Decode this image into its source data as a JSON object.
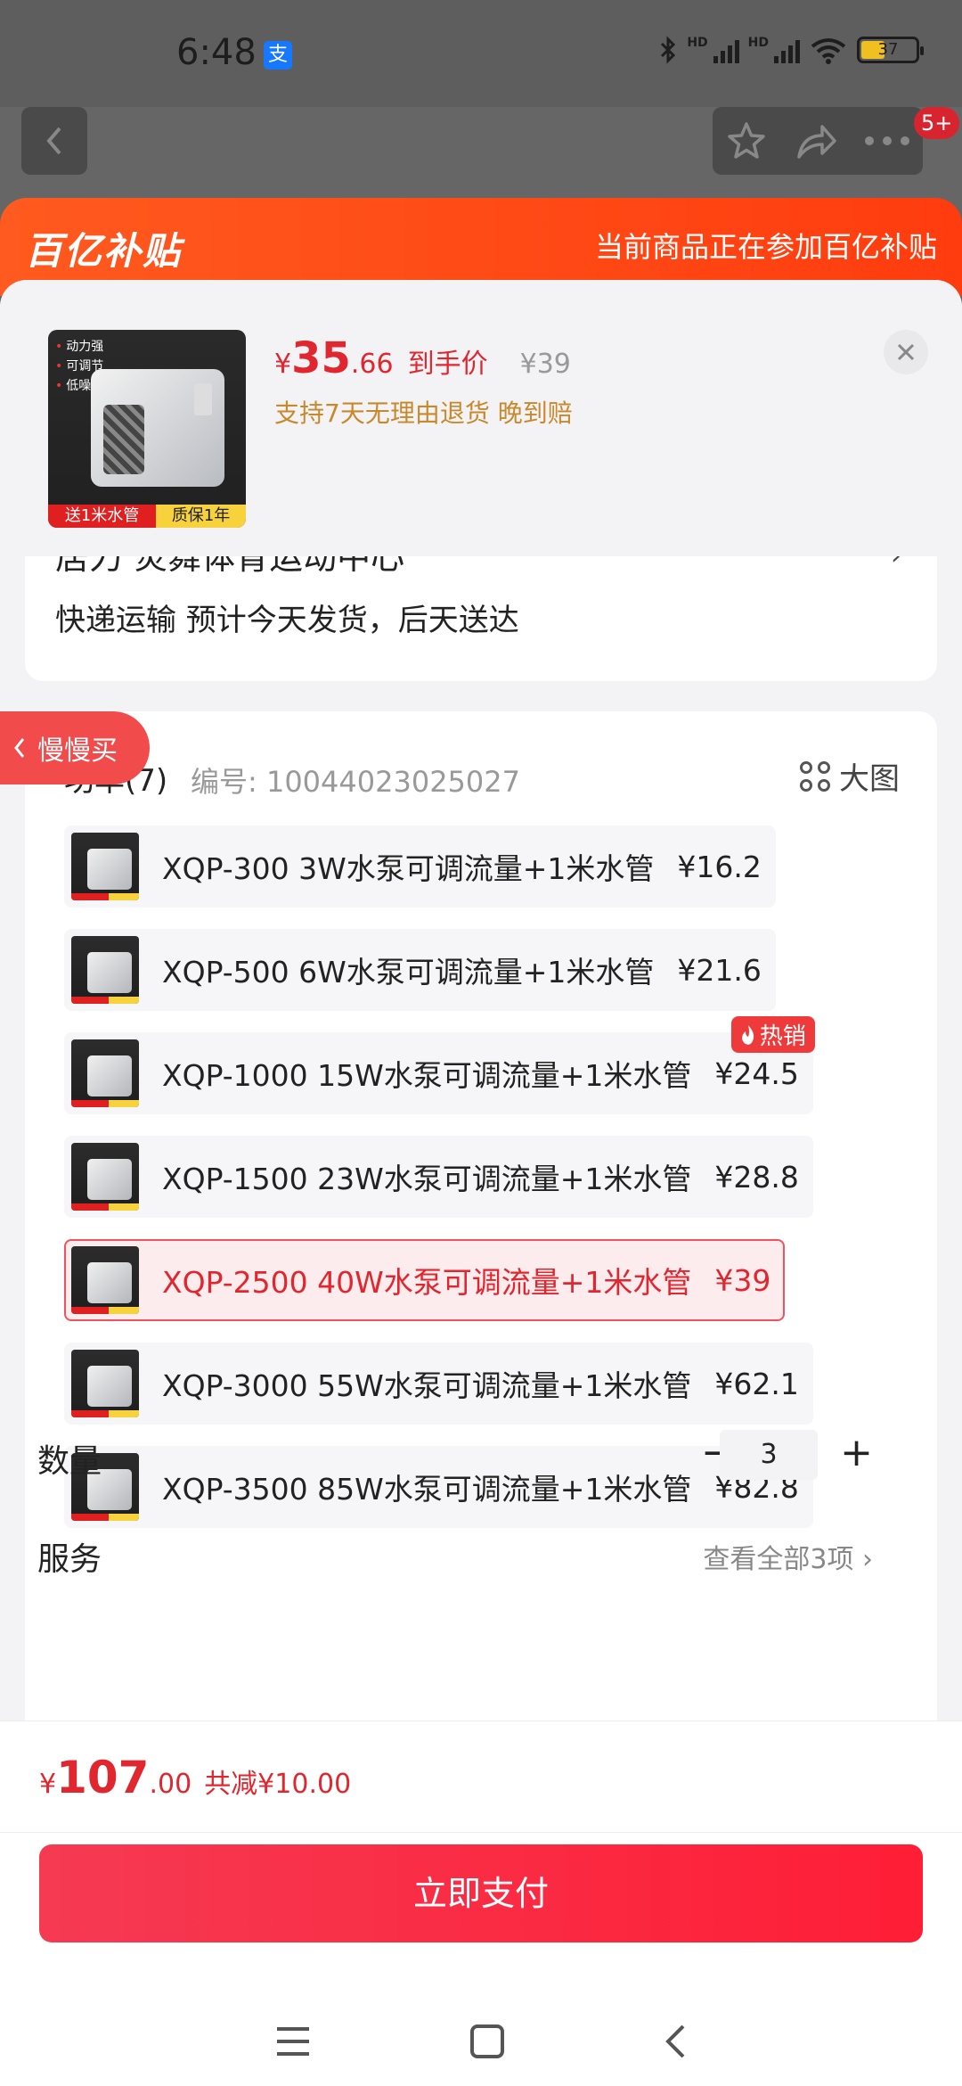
{
  "status": {
    "time": "6:48",
    "alipay": "支",
    "net1": "HD",
    "net2": "HD",
    "battery": "37"
  },
  "nav": {
    "badge": "5+"
  },
  "banner": {
    "logo": "百亿补贴",
    "text": "当前商品正在参加百亿补贴"
  },
  "product": {
    "thumb_tags": [
      "动力强",
      "可调节",
      "低噪音"
    ],
    "thumb_promo_left": "送1米水管",
    "thumb_promo_right": "质保1年",
    "price_symbol": "¥",
    "price_int": "35",
    "price_dec": ".66",
    "price_label": "到手价",
    "original_price": "¥39",
    "promise": "支持7天无理由退货  晚到赔"
  },
  "shipping": {
    "address_partial": "居力  炎舞体育运动中心",
    "arrow": "›",
    "text": "快递运输 预计今天发货，后天送达"
  },
  "side_tab": {
    "label": "慢慢买"
  },
  "options": {
    "title": "功率(7)",
    "code": "编号: 10044023025027",
    "view_label": "大图",
    "hot_label": "热销",
    "items": [
      {
        "name": "XQP-300 3W水泵可调流量+1米水管",
        "price": "¥16.2"
      },
      {
        "name": "XQP-500 6W水泵可调流量+1米水管",
        "price": "¥21.6"
      },
      {
        "name": "XQP-1000 15W水泵可调流量+1米水管",
        "price": "¥24.5"
      },
      {
        "name": "XQP-1500 23W水泵可调流量+1米水管",
        "price": "¥28.8"
      },
      {
        "name": "XQP-2500 40W水泵可调流量+1米水管",
        "price": "¥39"
      },
      {
        "name": "XQP-3000 55W水泵可调流量+1米水管",
        "price": "¥62.1"
      },
      {
        "name": "XQP-3500 85W水泵可调流量+1米水管",
        "price": "¥82.8"
      }
    ],
    "selected_index": 4,
    "hot_index": 2
  },
  "quantity": {
    "label": "数量",
    "minus": "−",
    "value": "3",
    "plus": "+"
  },
  "service": {
    "label": "服务",
    "link": "查看全部3项 ›"
  },
  "checkout": {
    "total_symbol": "¥",
    "total_int": "107",
    "total_dec": ".00",
    "savings": "共减¥10.00",
    "pay_label": "立即支付"
  },
  "colors": {
    "accent": "#e0262f",
    "banner": "#ff4a16",
    "pay": "#fe1e36"
  }
}
